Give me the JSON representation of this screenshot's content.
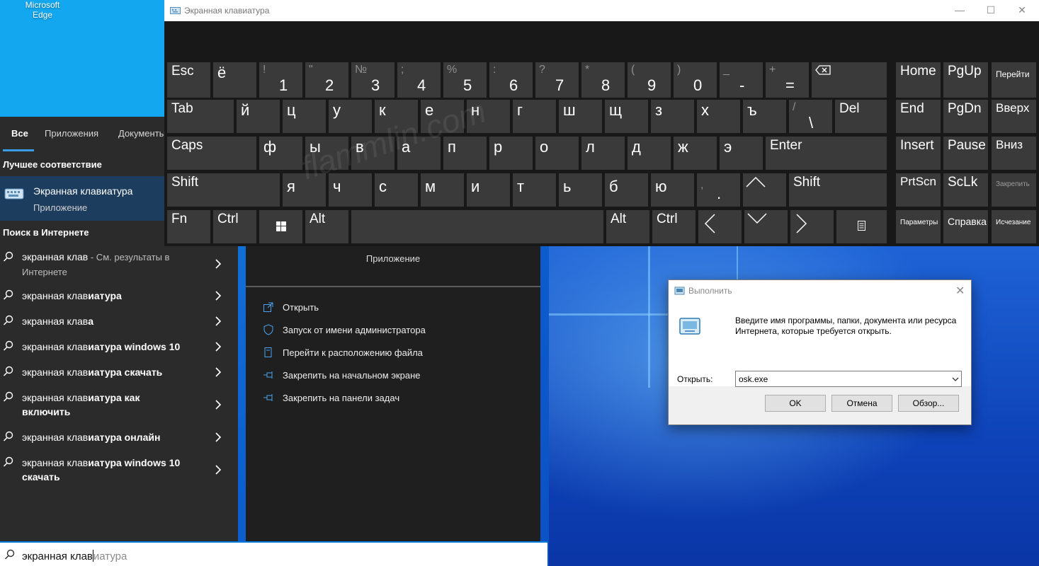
{
  "desktop": {
    "edge_label": "Microsoft Edge"
  },
  "start": {
    "tabs": [
      "Все",
      "Приложения",
      "Документы"
    ],
    "best_match_header": "Лучшее соответствие",
    "best_match": {
      "title": "Экранная клавиатура",
      "subtitle": "Приложение"
    },
    "web_header": "Поиск в Интернете",
    "web_results": [
      {
        "prefix": "экранная клав",
        "bold": "",
        "suffix": " - См. результаты в Интернете"
      },
      {
        "prefix": "экранная клав",
        "bold": "иатура",
        "suffix": ""
      },
      {
        "prefix": "экранная клав",
        "bold": "а",
        "suffix": ""
      },
      {
        "prefix": "экранная клав",
        "bold": "иатура windows 10",
        "suffix": ""
      },
      {
        "prefix": "экранная клав",
        "bold": "иатура скачать",
        "suffix": ""
      },
      {
        "prefix": "экранная клав",
        "bold": "иатура как включить",
        "suffix": ""
      },
      {
        "prefix": "экранная клав",
        "bold": "иатура онлайн",
        "suffix": ""
      },
      {
        "prefix": "экранная клав",
        "bold": "иатура windows 10 скачать",
        "suffix": ""
      }
    ],
    "detail_subtitle": "Приложение",
    "actions": [
      "Открыть",
      "Запуск от имени администратора",
      "Перейти к расположению файла",
      "Закрепить на начальном экране",
      "Закрепить на панели задач"
    ],
    "search_typed": "экранная клав",
    "search_ghost": "иатура"
  },
  "osk": {
    "title": "Экранная клавиатура",
    "keys": {
      "esc": "Esc",
      "yo": "ё",
      "d1s": "!",
      "d1": "1",
      "d2s": "\"",
      "d2": "2",
      "d3s": "№",
      "d3": "3",
      "d4s": ";",
      "d4": "4",
      "d5s": "%",
      "d5": "5",
      "d6s": ":",
      "d6": "6",
      "d7s": "?",
      "d7": "7",
      "d8s": "*",
      "d8": "8",
      "d9s": "(",
      "d9": "9",
      "d0s": ")",
      "d0": "0",
      "mins": "_",
      "min": "-",
      "eqs": "+",
      "eq": "=",
      "tab": "Tab",
      "r1": [
        "й",
        "ц",
        "у",
        "к",
        "е",
        "н",
        "г",
        "ш",
        "щ",
        "з",
        "х",
        "ъ"
      ],
      "bss": "/",
      "bs": "\\",
      "del": "Del",
      "caps": "Caps",
      "r2": [
        "ф",
        "ы",
        "в",
        "а",
        "п",
        "р",
        "о",
        "л",
        "д",
        "ж",
        "э"
      ],
      "enter": "Enter",
      "shift": "Shift",
      "r3": [
        "я",
        "ч",
        "с",
        "м",
        "и",
        "т",
        "ь",
        "б",
        "ю"
      ],
      "dots": ",",
      "dot": ".",
      "shift_r": "Shift",
      "fn": "Fn",
      "ctrl": "Ctrl",
      "alt": "Alt",
      "alt_r": "Alt",
      "ctrl_r": "Ctrl",
      "home": "Home",
      "pgup": "PgUp",
      "goto": "Перейти",
      "end": "End",
      "pgdn": "PgDn",
      "up": "Вверх",
      "insert": "Insert",
      "pause": "Pause",
      "down": "Вниз",
      "prtscn": "PrtScn",
      "sclk": "ScLk",
      "lock": "Закрепить",
      "params": "Параметры",
      "help": "Справка",
      "fade": "Исчезание"
    }
  },
  "run": {
    "title": "Выполнить",
    "description": "Введите имя программы, папки, документа или ресурса Интернета, которые требуется открыть.",
    "open_label": "Открыть:",
    "input_value": "osk.exe",
    "ok": "OK",
    "cancel": "Отмена",
    "browse": "Обзор..."
  },
  "watermark": "flammlin.com"
}
